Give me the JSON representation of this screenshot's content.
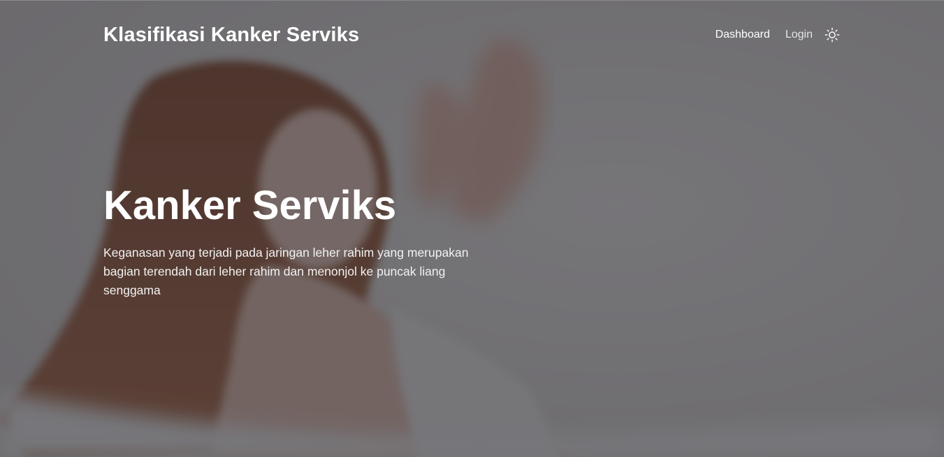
{
  "navbar": {
    "brand": "Klasifikasi Kanker Serviks",
    "links": [
      {
        "label": "Dashboard"
      },
      {
        "label": "Login"
      }
    ],
    "theme_icon": "sun-icon"
  },
  "hero": {
    "title": "Kanker Serviks",
    "description": "Keganasan yang terjadi pada jaringan leher rahim yang merupakan bagian terendah dari leher rahim dan menonjol ke puncak liang senggama",
    "background_image": "woman-lying-on-bed-photo"
  },
  "colors": {
    "overlay": "#28282e",
    "text": "#ffffff"
  }
}
